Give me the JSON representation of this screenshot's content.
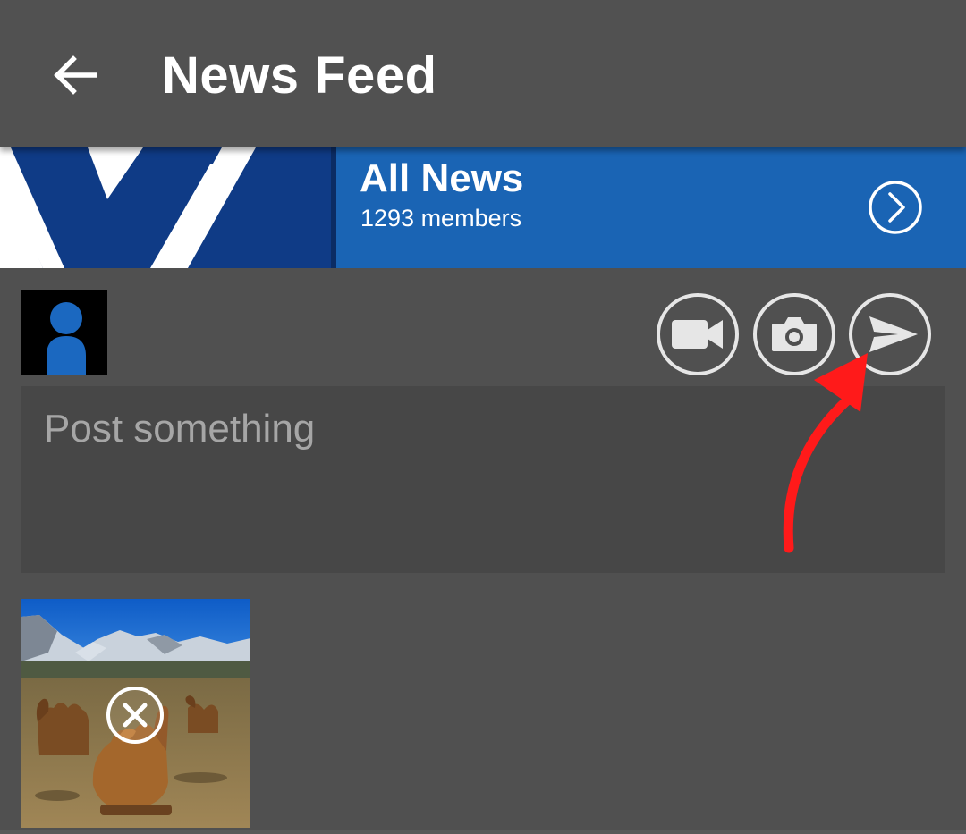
{
  "toolbar": {
    "title": "News Feed",
    "back_icon": "arrow-left-icon"
  },
  "group": {
    "name": "All News",
    "members": "1293 members",
    "open_icon": "chevron-right-circle-icon",
    "banner_color": "#1a64b4",
    "logo_color": "#0f3b86"
  },
  "composer": {
    "placeholder": "Post something",
    "value": "",
    "avatar_icon": "user-avatar-icon",
    "actions": [
      {
        "name": "video",
        "icon": "video-camera-icon"
      },
      {
        "name": "photo",
        "icon": "camera-icon"
      },
      {
        "name": "send",
        "icon": "send-icon"
      }
    ]
  },
  "attachment": {
    "remove_icon": "close-circle-icon",
    "image_subject": "camels-mountains-photo"
  },
  "annotation": {
    "color": "#ff1a1a",
    "icon": "red-arrow-annotation"
  }
}
